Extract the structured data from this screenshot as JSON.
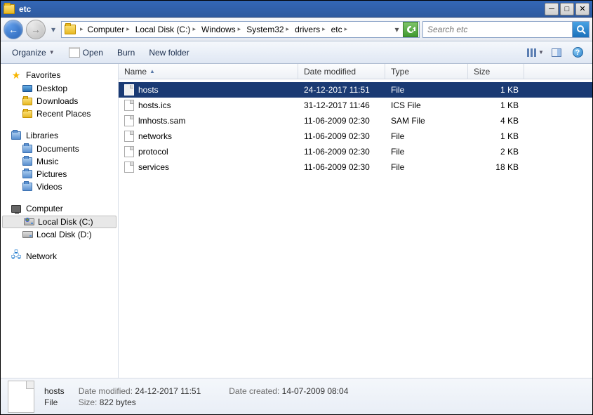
{
  "window": {
    "title": "etc"
  },
  "breadcrumb": [
    {
      "label": "Computer"
    },
    {
      "label": "Local Disk (C:)"
    },
    {
      "label": "Windows"
    },
    {
      "label": "System32"
    },
    {
      "label": "drivers"
    },
    {
      "label": "etc"
    }
  ],
  "search": {
    "placeholder": "Search etc"
  },
  "toolbar": {
    "organize": "Organize",
    "open": "Open",
    "burn": "Burn",
    "new_folder": "New folder"
  },
  "sidebar": {
    "favorites": {
      "label": "Favorites",
      "items": [
        {
          "label": "Desktop",
          "icon": "desktop"
        },
        {
          "label": "Downloads",
          "icon": "folder"
        },
        {
          "label": "Recent Places",
          "icon": "folder"
        }
      ]
    },
    "libraries": {
      "label": "Libraries",
      "items": [
        {
          "label": "Documents",
          "icon": "lib"
        },
        {
          "label": "Music",
          "icon": "lib"
        },
        {
          "label": "Pictures",
          "icon": "lib"
        },
        {
          "label": "Videos",
          "icon": "lib"
        }
      ]
    },
    "computer": {
      "label": "Computer",
      "items": [
        {
          "label": "Local Disk (C:)",
          "icon": "drive-win",
          "selected": true
        },
        {
          "label": "Local Disk (D:)",
          "icon": "drive"
        }
      ]
    },
    "network": {
      "label": "Network"
    }
  },
  "columns": {
    "name": "Name",
    "date": "Date modified",
    "type": "Type",
    "size": "Size"
  },
  "col_widths": {
    "name": 256,
    "date": 124,
    "type": 118,
    "size": 80
  },
  "files": [
    {
      "name": "hosts",
      "date": "24-12-2017 11:51",
      "type": "File",
      "size": "1 KB",
      "selected": true
    },
    {
      "name": "hosts.ics",
      "date": "31-12-2017 11:46",
      "type": "ICS File",
      "size": "1 KB"
    },
    {
      "name": "lmhosts.sam",
      "date": "11-06-2009 02:30",
      "type": "SAM File",
      "size": "4 KB"
    },
    {
      "name": "networks",
      "date": "11-06-2009 02:30",
      "type": "File",
      "size": "1 KB"
    },
    {
      "name": "protocol",
      "date": "11-06-2009 02:30",
      "type": "File",
      "size": "2 KB"
    },
    {
      "name": "services",
      "date": "11-06-2009 02:30",
      "type": "File",
      "size": "18 KB"
    }
  ],
  "details": {
    "name": "hosts",
    "type": "File",
    "date_modified_label": "Date modified:",
    "date_modified": "24-12-2017 11:51",
    "size_label": "Size:",
    "size": "822 bytes",
    "date_created_label": "Date created:",
    "date_created": "14-07-2009 08:04"
  }
}
